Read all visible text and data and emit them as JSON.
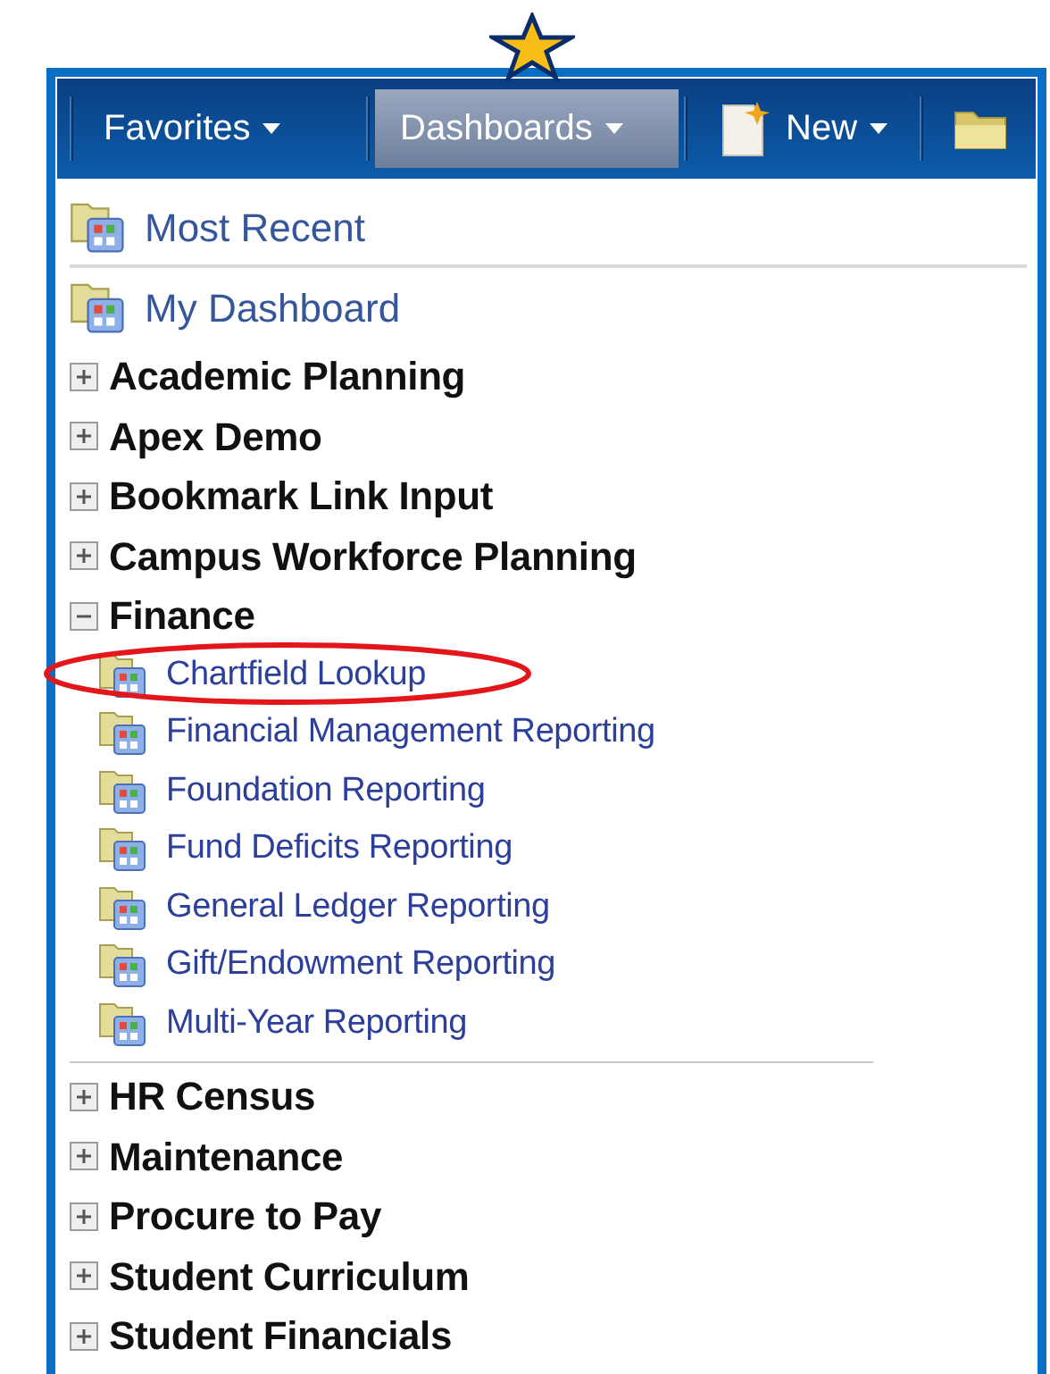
{
  "toolbar": [
    {
      "kind": "menu",
      "label": "Favorites",
      "selected": false
    },
    {
      "kind": "menu",
      "label": "Dashboards",
      "selected": true
    },
    {
      "kind": "new",
      "label": "New",
      "selected": false
    },
    {
      "kind": "folder",
      "selected": false
    }
  ],
  "recent": [
    {
      "label": "Most Recent"
    },
    {
      "label": "My Dashboard"
    }
  ],
  "groups_before": [
    {
      "label": "Academic Planning",
      "expanded": false
    },
    {
      "label": "Apex Demo",
      "expanded": false
    },
    {
      "label": "Bookmark Link Input",
      "expanded": false
    },
    {
      "label": "Campus Workforce Planning",
      "expanded": false
    },
    {
      "label": "Finance",
      "expanded": true,
      "children": [
        {
          "label": "Chartfield Lookup",
          "circled": true
        },
        {
          "label": "Financial Management Reporting",
          "circled": false
        },
        {
          "label": "Foundation Reporting",
          "circled": false
        },
        {
          "label": "Fund Deficits Reporting",
          "circled": false
        },
        {
          "label": "General Ledger Reporting",
          "circled": false
        },
        {
          "label": "Gift/Endowment Reporting",
          "circled": false
        },
        {
          "label": "Multi-Year Reporting",
          "circled": false
        }
      ]
    }
  ],
  "groups_after": [
    {
      "label": "HR Census",
      "expanded": false
    },
    {
      "label": "Maintenance",
      "expanded": false
    },
    {
      "label": "Procure to Pay",
      "expanded": false
    },
    {
      "label": "Student Curriculum",
      "expanded": false
    },
    {
      "label": "Student Financials",
      "expanded": false
    }
  ]
}
